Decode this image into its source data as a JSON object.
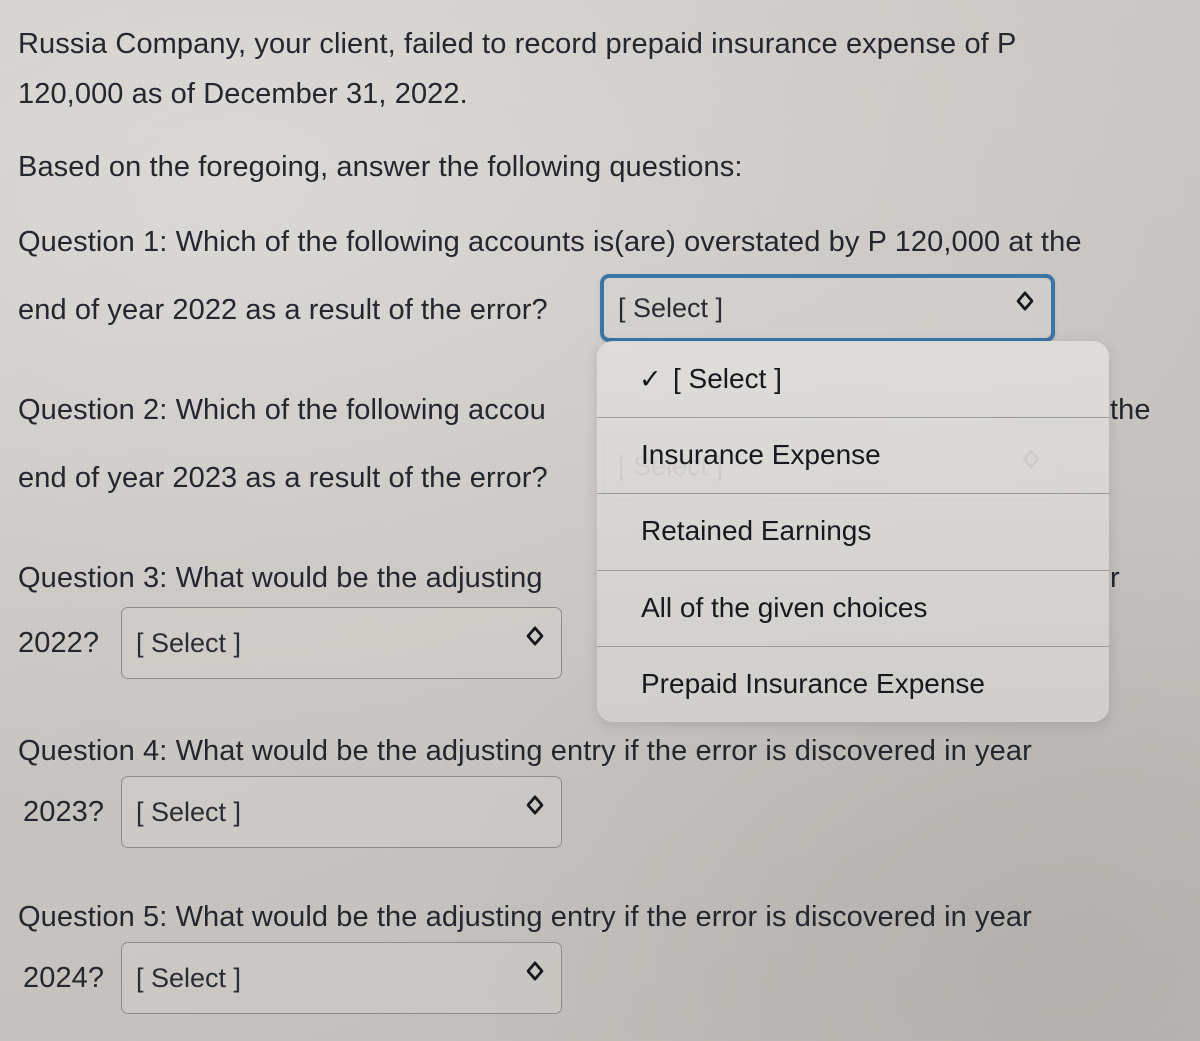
{
  "document": {
    "intro_line_1": "Russia Company, your client, failed to record prepaid insurance expense of P",
    "intro_line_2": "120,000 as of December 31, 2022.",
    "instruction": "Based on the foregoing, answer the following questions:"
  },
  "questions": [
    {
      "id": "q1",
      "line_1": "Question 1: Which of the following accounts is(are) overstated by P 120,000 at the",
      "line_2": "end of year 2022 as a result of the error?",
      "select_value": "[ Select ]",
      "state": "open"
    },
    {
      "id": "q2",
      "line_1_visible": "Question 2: Which of the following accou",
      "line_1_tail": "the",
      "line_2": "end of year 2023 as a result of the error?",
      "select_value": "[ Select ]",
      "state": "occluded"
    },
    {
      "id": "q3",
      "line_1_visible": "Question 3: What would be the adjusting",
      "line_1_tail": "r",
      "line_2_prefix": "2022?",
      "select_value": "[ Select ]",
      "state": "closed"
    },
    {
      "id": "q4",
      "line_1": "Question 4: What would be the adjusting entry if the error is discovered in year",
      "line_2_prefix": "2023?",
      "select_value": "[ Select ]",
      "state": "closed"
    },
    {
      "id": "q5",
      "line_1": "Question 5: What would be the adjusting entry if the error is discovered in year",
      "line_2_prefix": "2024?",
      "select_value": "[ Select ]",
      "state": "closed"
    }
  ],
  "dropdown": {
    "open_for": "q1",
    "checked_index": 0,
    "check_glyph": "✓",
    "options": [
      "[ Select ]",
      "Insurance Expense",
      "Retained Earnings",
      "All of the given choices",
      "Prepaid Insurance Expense"
    ]
  },
  "icons": {
    "chevron_updown": "⌃⌄",
    "chevron_glyph": "⇅"
  },
  "colors": {
    "page_background": "#c9c7c3",
    "text": "#24262e",
    "focus_border": "#3c74a6",
    "select_border": "#8e8c88",
    "dropdown_background": "#d8d6d2"
  }
}
